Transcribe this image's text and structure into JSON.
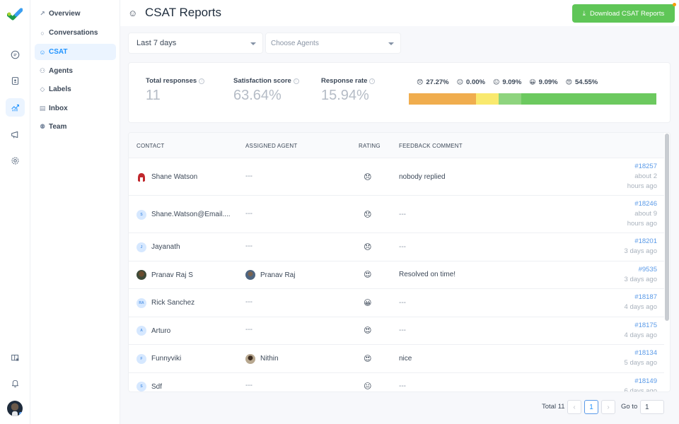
{
  "rail": {
    "logo": "app-logo",
    "items": [
      {
        "icon": "chat-icon",
        "label": "Conversations"
      },
      {
        "icon": "contacts-icon",
        "label": "Contacts"
      },
      {
        "icon": "reports-icon",
        "label": "Reports",
        "active": true
      },
      {
        "icon": "campaigns-icon",
        "label": "Campaigns"
      },
      {
        "icon": "settings-icon",
        "label": "Settings"
      }
    ],
    "bottom": [
      {
        "icon": "dashboard-apps-icon"
      },
      {
        "icon": "notifications-icon"
      }
    ]
  },
  "subnav": {
    "items": [
      {
        "label": "Overview",
        "icon": "↗"
      },
      {
        "label": "Conversations",
        "icon": "○"
      },
      {
        "label": "CSAT",
        "icon": "☺",
        "active": true
      },
      {
        "label": "Agents",
        "icon": "⚇"
      },
      {
        "label": "Labels",
        "icon": "◇"
      },
      {
        "label": "Inbox",
        "icon": "▤"
      },
      {
        "label": "Team",
        "icon": "⚉"
      }
    ]
  },
  "header": {
    "title": "CSAT Reports",
    "title_icon": "☺",
    "download_label": "Download CSAT Reports",
    "download_icon": "⤓"
  },
  "filters": {
    "date_range": "Last 7 days",
    "agents_placeholder": "Choose Agents"
  },
  "metrics": {
    "total_responses": {
      "label": "Total responses",
      "value": "11"
    },
    "satisfaction_score": {
      "label": "Satisfaction score",
      "value": "63.64%"
    },
    "response_rate": {
      "label": "Response rate",
      "value": "15.94%"
    },
    "info_glyph": "i"
  },
  "rating_distribution": [
    {
      "emoji": "😞",
      "percent": "27.27%",
      "value": 27.27,
      "color": "#f0ad4e"
    },
    {
      "emoji": "😑",
      "percent": "0.00%",
      "value": 0.0,
      "color": "#f7e26b"
    },
    {
      "emoji": "😐",
      "percent": "9.09%",
      "value": 9.09,
      "color": "#f9e96e"
    },
    {
      "emoji": "😀",
      "percent": "9.09%",
      "value": 9.09,
      "color": "#8ed47e"
    },
    {
      "emoji": "😍",
      "percent": "54.55%",
      "value": 54.55,
      "color": "#6cc95f"
    }
  ],
  "table": {
    "columns": [
      "CONTACT",
      "ASSIGNED AGENT",
      "RATING",
      "FEEDBACK COMMENT"
    ],
    "rows": [
      {
        "contact": "Shane Watson",
        "avatar": "helmet",
        "initials": "",
        "agent": "---",
        "agent_avatar": "",
        "rating": "😞",
        "comment": "nobody replied",
        "conversation": "#18257",
        "time": [
          "about 2",
          "hours ago"
        ]
      },
      {
        "contact": "Shane.Watson@Email....",
        "avatar": "initials",
        "initials": "S",
        "agent": "---",
        "agent_avatar": "",
        "rating": "😞",
        "comment": "---",
        "conversation": "#18246",
        "time": [
          "about 9",
          "hours ago"
        ]
      },
      {
        "contact": "Jayanath",
        "avatar": "initials",
        "initials": "J",
        "agent": "---",
        "agent_avatar": "",
        "rating": "😞",
        "comment": "---",
        "conversation": "#18201",
        "time": [
          "3 days ago"
        ]
      },
      {
        "contact": "Pranav Raj S",
        "avatar": "photo1",
        "initials": "",
        "agent": "Pranav Raj",
        "agent_avatar": "photo2",
        "rating": "😍",
        "comment": "Resolved on time!",
        "conversation": "#9535",
        "time": [
          "3 days ago"
        ]
      },
      {
        "contact": "Rick Sanchez",
        "avatar": "initials",
        "initials": "RA",
        "agent": "---",
        "agent_avatar": "",
        "rating": "😀",
        "comment": "---",
        "conversation": "#18187",
        "time": [
          "4 days ago"
        ]
      },
      {
        "contact": "Arturo",
        "avatar": "initials",
        "initials": "A",
        "agent": "---",
        "agent_avatar": "",
        "rating": "😍",
        "comment": "---",
        "conversation": "#18175",
        "time": [
          "4 days ago"
        ]
      },
      {
        "contact": "Funnyviki",
        "avatar": "initials",
        "initials": "F",
        "agent": "Nithin",
        "agent_avatar": "photo3",
        "rating": "😍",
        "comment": "nice",
        "conversation": "#18134",
        "time": [
          "5 days ago"
        ]
      },
      {
        "contact": "Sdf",
        "avatar": "initials",
        "initials": "S",
        "agent": "---",
        "agent_avatar": "",
        "rating": "😐",
        "comment": "---",
        "conversation": "#18149",
        "time": [
          "6 days ago"
        ]
      }
    ]
  },
  "pagination": {
    "total_label": "Total 11",
    "prev": "‹",
    "current_page": "1",
    "next": "›",
    "goto_label": "Go to",
    "goto_value": "1"
  }
}
